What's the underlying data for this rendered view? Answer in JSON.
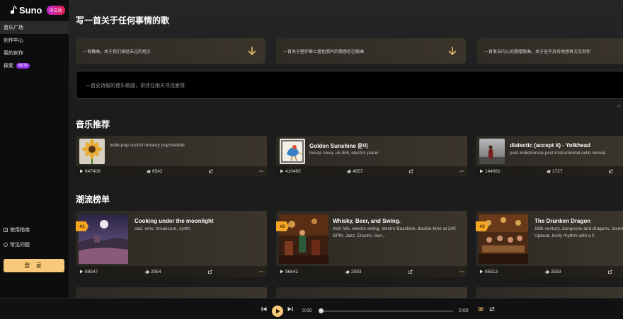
{
  "app": {
    "name": "Suno",
    "badge": "中文站"
  },
  "sidebar": {
    "items": [
      {
        "label": "音乐广场",
        "active": true
      },
      {
        "label": "创作中心"
      },
      {
        "label": "我的创作"
      },
      {
        "label": "探索",
        "badge": "BETA"
      }
    ],
    "guide": "使用指南",
    "faq": "常见问题",
    "login": "登 录"
  },
  "main": {
    "title": "写一首关于任何事情的歌",
    "prompts": [
      "一首舞曲，关于我们曾经去过的地方",
      "一首关于壁炉噼上摆色照片的情感伦巴歌曲",
      "一首发自内心的震嘘歌曲，关于迫不及待地想再次见到你"
    ],
    "input_placeholder": "一首史诗般的音乐歌曲，讲述在雨天寻找爱情",
    "tiny_right": "(0",
    "recommend_title": "音乐推荐",
    "recommend": [
      {
        "title": "",
        "tags": "indie-pop soulful dreamy psychedelic",
        "plays": "647409",
        "likes": "6542"
      },
      {
        "title": "Golden Sunshine 윤이",
        "tags": "bossa nova, uk drill, electric piano",
        "plays": "410465",
        "likes": "4857"
      },
      {
        "title": "dialectic (accept it) - Yolkhead",
        "tags": "post-indietronica post-instrumental cello revival",
        "plays": "144061",
        "likes": "1727"
      }
    ],
    "trending_title": "潮流榜单",
    "trending": [
      {
        "rank": "#1",
        "title": "Cooking under the moonlight",
        "tags": "sad. emo, breakcore, synth,",
        "plays": "89547",
        "likes": "2054"
      },
      {
        "rank": "#2",
        "title": "Whisky, Beer, and Swing.",
        "tags": "irish folk, electro swing, electro Basslinie, double-time at 240 BPM, Jazz, Electro, Swi...",
        "plays": "96641",
        "likes": "2593"
      },
      {
        "rank": "#3",
        "title": "The Drunken Dragon",
        "tags": "16th century, dungeons and dragons, tavern, Upbeat, lively rhythm with a fi",
        "plays": "95513",
        "likes": "2559"
      }
    ]
  },
  "player": {
    "current": "0:00",
    "duration": "0:00",
    "progress": 0
  },
  "colors": {
    "accent": "#f8c97a",
    "rank": "#f5a524",
    "beta": "#9333ea"
  },
  "icons": [
    "suno-logo-icon",
    "arrow-down-icon",
    "play-icon",
    "like-icon",
    "share-icon",
    "more-icon",
    "book-icon",
    "help-icon",
    "prev-icon",
    "next-icon",
    "loop-icon",
    "shuffle-icon"
  ]
}
